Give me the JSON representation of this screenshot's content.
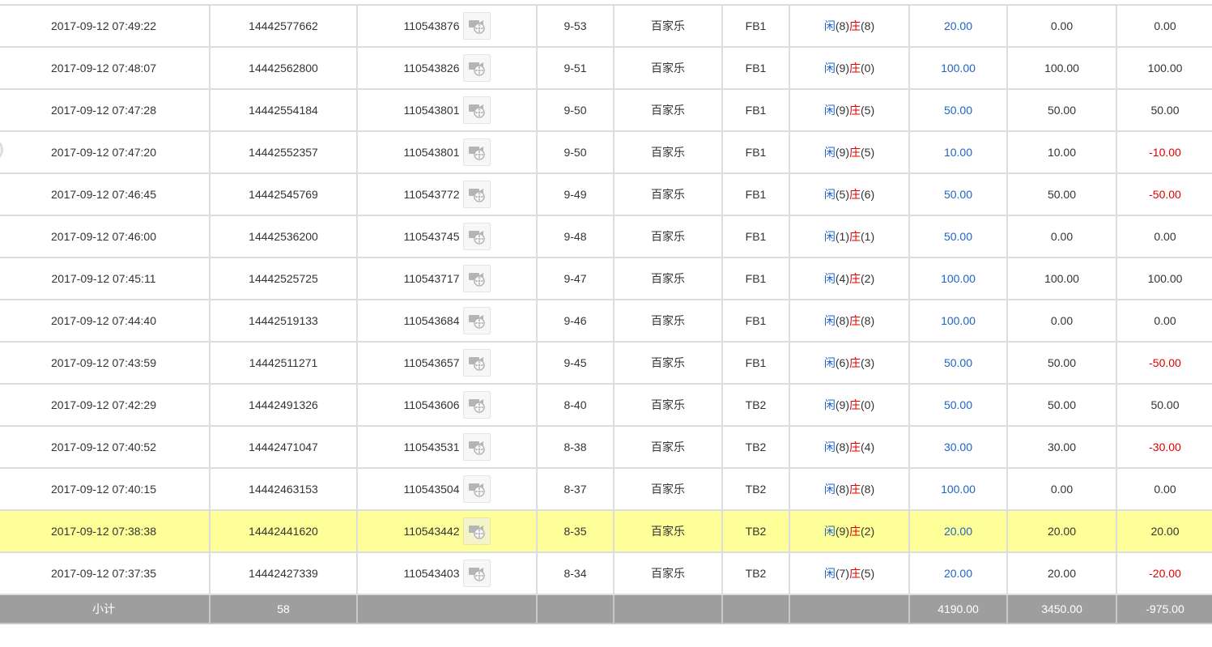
{
  "labels": {
    "player": "闲",
    "banker": "庄"
  },
  "icons": {
    "replay": "video-replay-icon"
  },
  "colors": {
    "blue": "#1e64c8",
    "red": "#e00000",
    "highlight": "#ffff99",
    "subtotal_bg": "#9e9e9e"
  },
  "rows": [
    {
      "time": "2017-09-12 07:49:22",
      "bet_no": "14442577662",
      "game_no": "110543876",
      "round": "9-53",
      "game": "百家乐",
      "table": "FB1",
      "p": "(8)",
      "b": "(8)",
      "bet": "20.00",
      "valid": "0.00",
      "win": "0.00",
      "win_red": false
    },
    {
      "time": "2017-09-12 07:48:07",
      "bet_no": "14442562800",
      "game_no": "110543826",
      "round": "9-51",
      "game": "百家乐",
      "table": "FB1",
      "p": "(9)",
      "b": "(0)",
      "bet": "100.00",
      "valid": "100.00",
      "win": "100.00",
      "win_red": false
    },
    {
      "time": "2017-09-12 07:47:28",
      "bet_no": "14442554184",
      "game_no": "110543801",
      "round": "9-50",
      "game": "百家乐",
      "table": "FB1",
      "p": "(9)",
      "b": "(5)",
      "bet": "50.00",
      "valid": "50.00",
      "win": "50.00",
      "win_red": false
    },
    {
      "time": "2017-09-12 07:47:20",
      "bet_no": "14442552357",
      "game_no": "110543801",
      "round": "9-50",
      "game": "百家乐",
      "table": "FB1",
      "p": "(9)",
      "b": "(5)",
      "bet": "10.00",
      "valid": "10.00",
      "win": "-10.00",
      "win_red": true
    },
    {
      "time": "2017-09-12 07:46:45",
      "bet_no": "14442545769",
      "game_no": "110543772",
      "round": "9-49",
      "game": "百家乐",
      "table": "FB1",
      "p": "(5)",
      "b": "(6)",
      "bet": "50.00",
      "valid": "50.00",
      "win": "-50.00",
      "win_red": true
    },
    {
      "time": "2017-09-12 07:46:00",
      "bet_no": "14442536200",
      "game_no": "110543745",
      "round": "9-48",
      "game": "百家乐",
      "table": "FB1",
      "p": "(1)",
      "b": "(1)",
      "bet": "50.00",
      "valid": "0.00",
      "win": "0.00",
      "win_red": false
    },
    {
      "time": "2017-09-12 07:45:11",
      "bet_no": "14442525725",
      "game_no": "110543717",
      "round": "9-47",
      "game": "百家乐",
      "table": "FB1",
      "p": "(4)",
      "b": "(2)",
      "bet": "100.00",
      "valid": "100.00",
      "win": "100.00",
      "win_red": false
    },
    {
      "time": "2017-09-12 07:44:40",
      "bet_no": "14442519133",
      "game_no": "110543684",
      "round": "9-46",
      "game": "百家乐",
      "table": "FB1",
      "p": "(8)",
      "b": "(8)",
      "bet": "100.00",
      "valid": "0.00",
      "win": "0.00",
      "win_red": false
    },
    {
      "time": "2017-09-12 07:43:59",
      "bet_no": "14442511271",
      "game_no": "110543657",
      "round": "9-45",
      "game": "百家乐",
      "table": "FB1",
      "p": "(6)",
      "b": "(3)",
      "bet": "50.00",
      "valid": "50.00",
      "win": "-50.00",
      "win_red": true
    },
    {
      "time": "2017-09-12 07:42:29",
      "bet_no": "14442491326",
      "game_no": "110543606",
      "round": "8-40",
      "game": "百家乐",
      "table": "TB2",
      "p": "(9)",
      "b": "(0)",
      "bet": "50.00",
      "valid": "50.00",
      "win": "50.00",
      "win_red": false
    },
    {
      "time": "2017-09-12 07:40:52",
      "bet_no": "14442471047",
      "game_no": "110543531",
      "round": "8-38",
      "game": "百家乐",
      "table": "TB2",
      "p": "(8)",
      "b": "(4)",
      "bet": "30.00",
      "valid": "30.00",
      "win": "-30.00",
      "win_red": true
    },
    {
      "time": "2017-09-12 07:40:15",
      "bet_no": "14442463153",
      "game_no": "110543504",
      "round": "8-37",
      "game": "百家乐",
      "table": "TB2",
      "p": "(8)",
      "b": "(8)",
      "bet": "100.00",
      "valid": "0.00",
      "win": "0.00",
      "win_red": false
    },
    {
      "time": "2017-09-12 07:38:38",
      "bet_no": "14442441620",
      "game_no": "110543442",
      "round": "8-35",
      "game": "百家乐",
      "table": "TB2",
      "p": "(9)",
      "b": "(2)",
      "bet": "20.00",
      "valid": "20.00",
      "win": "20.00",
      "win_red": false,
      "highlight": true
    },
    {
      "time": "2017-09-12 07:37:35",
      "bet_no": "14442427339",
      "game_no": "110543403",
      "round": "8-34",
      "game": "百家乐",
      "table": "TB2",
      "p": "(7)",
      "b": "(5)",
      "bet": "20.00",
      "valid": "20.00",
      "win": "-20.00",
      "win_red": true
    }
  ],
  "subtotal": {
    "label": "小计",
    "count": "58",
    "bet": "4190.00",
    "valid": "3450.00",
    "win": "-975.00"
  }
}
